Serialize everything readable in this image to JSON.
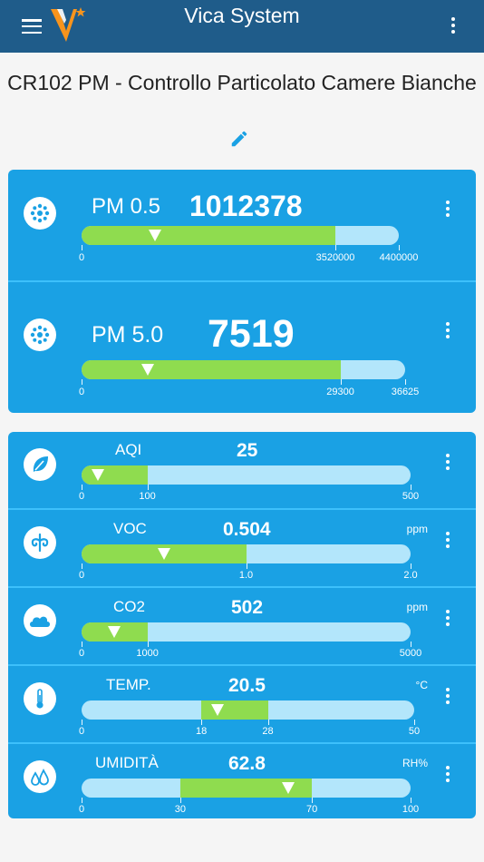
{
  "appbar": {
    "title": "Vica System"
  },
  "page": {
    "title": "CR102 PM - Controllo Particolato Camere Bianche"
  },
  "colors": {
    "appbar": "#1f5c8a",
    "card": "#1aa1e4",
    "bar_track": "#b3e6fb",
    "bar_fill": "#8fdc4f",
    "logo": "#f7941d"
  },
  "sensors": [
    {
      "id": "pm05",
      "icon": "particles-icon",
      "label": "PM 0.5",
      "value": "1012378",
      "unit": "",
      "ticks": [
        "0",
        "3520000",
        "4400000"
      ],
      "range": [
        0,
        4400000
      ],
      "green": [
        0,
        3520000
      ],
      "marker": 1012378
    },
    {
      "id": "pm50",
      "icon": "particles-icon",
      "label": "PM 5.0",
      "value": "7519",
      "unit": "",
      "ticks": [
        "0",
        "29300",
        "36625"
      ],
      "range": [
        0,
        36625
      ],
      "green": [
        0,
        29300
      ],
      "marker": 7519
    },
    {
      "id": "aqi",
      "icon": "leaf-icon",
      "label": "AQI",
      "value": "25",
      "unit": "",
      "ticks": [
        "0",
        "100",
        "500"
      ],
      "range": [
        0,
        500
      ],
      "green": [
        0,
        100
      ],
      "marker": 25
    },
    {
      "id": "voc",
      "icon": "air-flow-icon",
      "label": "VOC",
      "value": "0.504",
      "unit": "ppm",
      "ticks": [
        "0",
        "1.0",
        "2.0"
      ],
      "range": [
        0,
        2
      ],
      "green": [
        0,
        1
      ],
      "marker": 0.504
    },
    {
      "id": "co2",
      "icon": "cloud-icon",
      "label": "CO2",
      "value": "502",
      "unit": "ppm",
      "ticks": [
        "0",
        "1000",
        "5000"
      ],
      "range": [
        0,
        5000
      ],
      "green": [
        0,
        1000
      ],
      "marker": 502
    },
    {
      "id": "temp",
      "icon": "thermometer-icon",
      "label": "TEMP.",
      "value": "20.5",
      "unit": "°C",
      "ticks": [
        "0",
        "18",
        "28",
        "50"
      ],
      "range": [
        0,
        50
      ],
      "green": [
        18,
        28
      ],
      "marker": 20.5
    },
    {
      "id": "hum",
      "icon": "water-drops-icon",
      "label": "UMIDITÀ",
      "value": "62.8",
      "unit": "RH%",
      "ticks": [
        "0",
        "30",
        "70",
        "100"
      ],
      "range": [
        0,
        100
      ],
      "green": [
        30,
        70
      ],
      "marker": 62.8
    }
  ]
}
